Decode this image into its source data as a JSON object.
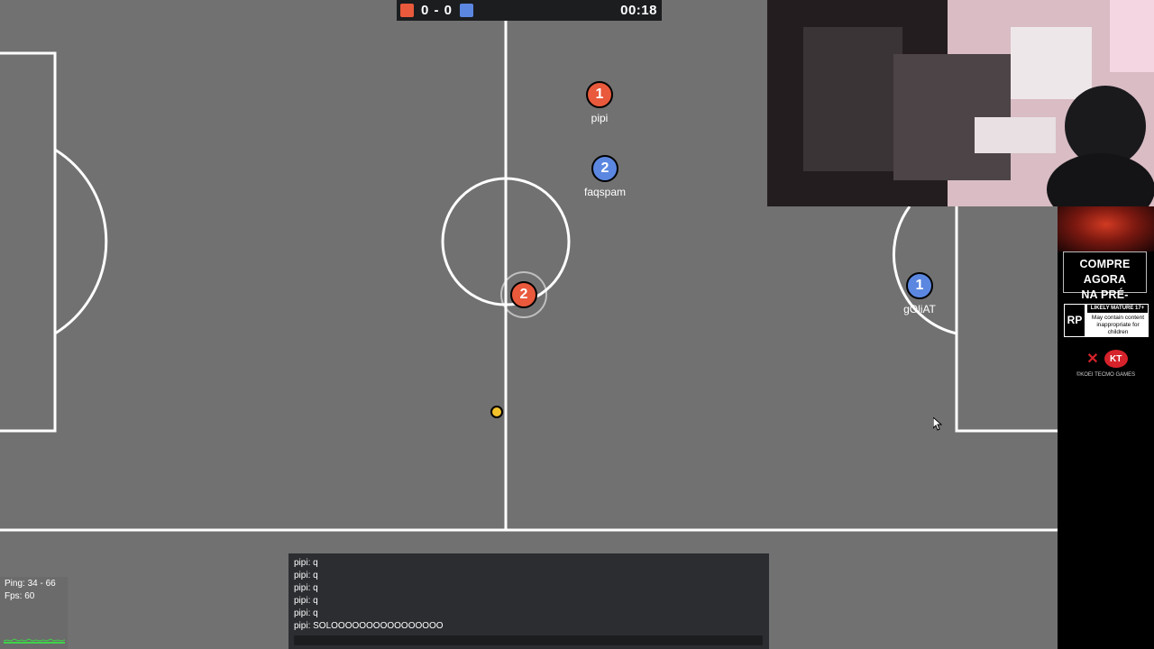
{
  "scoreboard": {
    "red_score": "0",
    "separator": "-",
    "blue_score": "0",
    "score_text": "0 - 0",
    "timer": "00:18",
    "red_color": "#e9593b",
    "blue_color": "#5b87e1"
  },
  "players": [
    {
      "number": "1",
      "name": "pipi",
      "team": "red"
    },
    {
      "number": "2",
      "name": "faqspam",
      "team": "blue"
    },
    {
      "number": "2",
      "name": "",
      "team": "red"
    },
    {
      "number": "1",
      "name": "gOliAT",
      "team": "blue"
    }
  ],
  "ball": {
    "color": "#f4c22b"
  },
  "perf": {
    "ping": "Ping: 34 - 66",
    "fps": "Fps: 60"
  },
  "chat": {
    "messages": [
      "pipi: q",
      "pipi: q",
      "pipi: q",
      "pipi: q",
      "pipi: q",
      "pipi: SOLOOOOOOOOOOOOOOOO"
    ]
  },
  "ad": {
    "cta_line1": "COMPRE AGORA",
    "cta_line2": "NA PRÉ-VENDA",
    "rating_code": "RP",
    "rating_title": "LIKELY MATURE 17+",
    "rating_desc": "May contain content inappropriate for children",
    "brand_ninja": "NINJA",
    "brand_kt": "KT",
    "copyright": "©KOEI TECMO GAMES"
  },
  "icons": {
    "cursor": "mouse-pointer-icon"
  }
}
